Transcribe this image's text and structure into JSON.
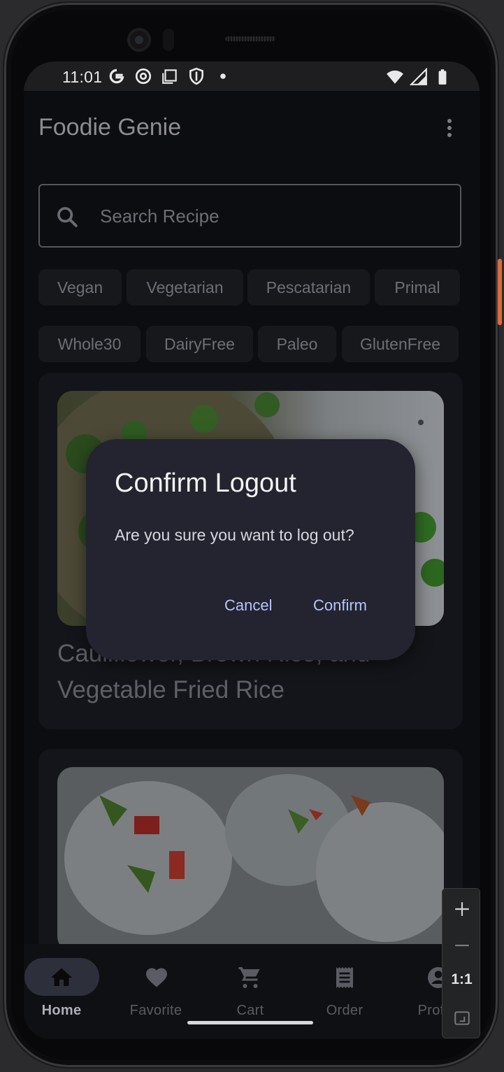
{
  "status_bar": {
    "time": "11:01",
    "left_icons": [
      "google-icon",
      "chrome-icon",
      "screenshot-icon",
      "shield-icon",
      "dot-icon"
    ],
    "right_icons": [
      "wifi-icon",
      "signal-icon",
      "battery-icon"
    ]
  },
  "app": {
    "title": "Foodie Genie",
    "menu_icon": "more-vert-icon"
  },
  "search": {
    "placeholder": "Search Recipe",
    "value": ""
  },
  "chips": {
    "row1": [
      "Vegan",
      "Vegetarian",
      "Pescatarian",
      "Primal"
    ],
    "row2": [
      "Whole30",
      "DairyFree",
      "Paleo",
      "GlutenFree"
    ]
  },
  "recipes": [
    {
      "title": "Cauliflower, Brown Rice, and Vegetable Fried Rice"
    },
    {
      "title": ""
    }
  ],
  "dialog": {
    "title": "Confirm Logout",
    "message": "Are you sure you want to log out?",
    "cancel_label": "Cancel",
    "confirm_label": "Confirm"
  },
  "bottom_nav": {
    "items": [
      {
        "label": "Home",
        "icon": "home-icon",
        "active": true
      },
      {
        "label": "Favorite",
        "icon": "heart-icon",
        "active": false
      },
      {
        "label": "Cart",
        "icon": "cart-icon",
        "active": false
      },
      {
        "label": "Order",
        "icon": "receipt-icon",
        "active": false
      },
      {
        "label": "Profile",
        "icon": "account-icon",
        "active": false
      }
    ]
  },
  "zoom_controls": {
    "zoom_in": "+",
    "zoom_out": "−",
    "reset_label": "1:1"
  },
  "colors": {
    "accent": "#b8c4ff",
    "dialog_bg": "#23242f",
    "nav_pill": "#2d2f3b"
  }
}
